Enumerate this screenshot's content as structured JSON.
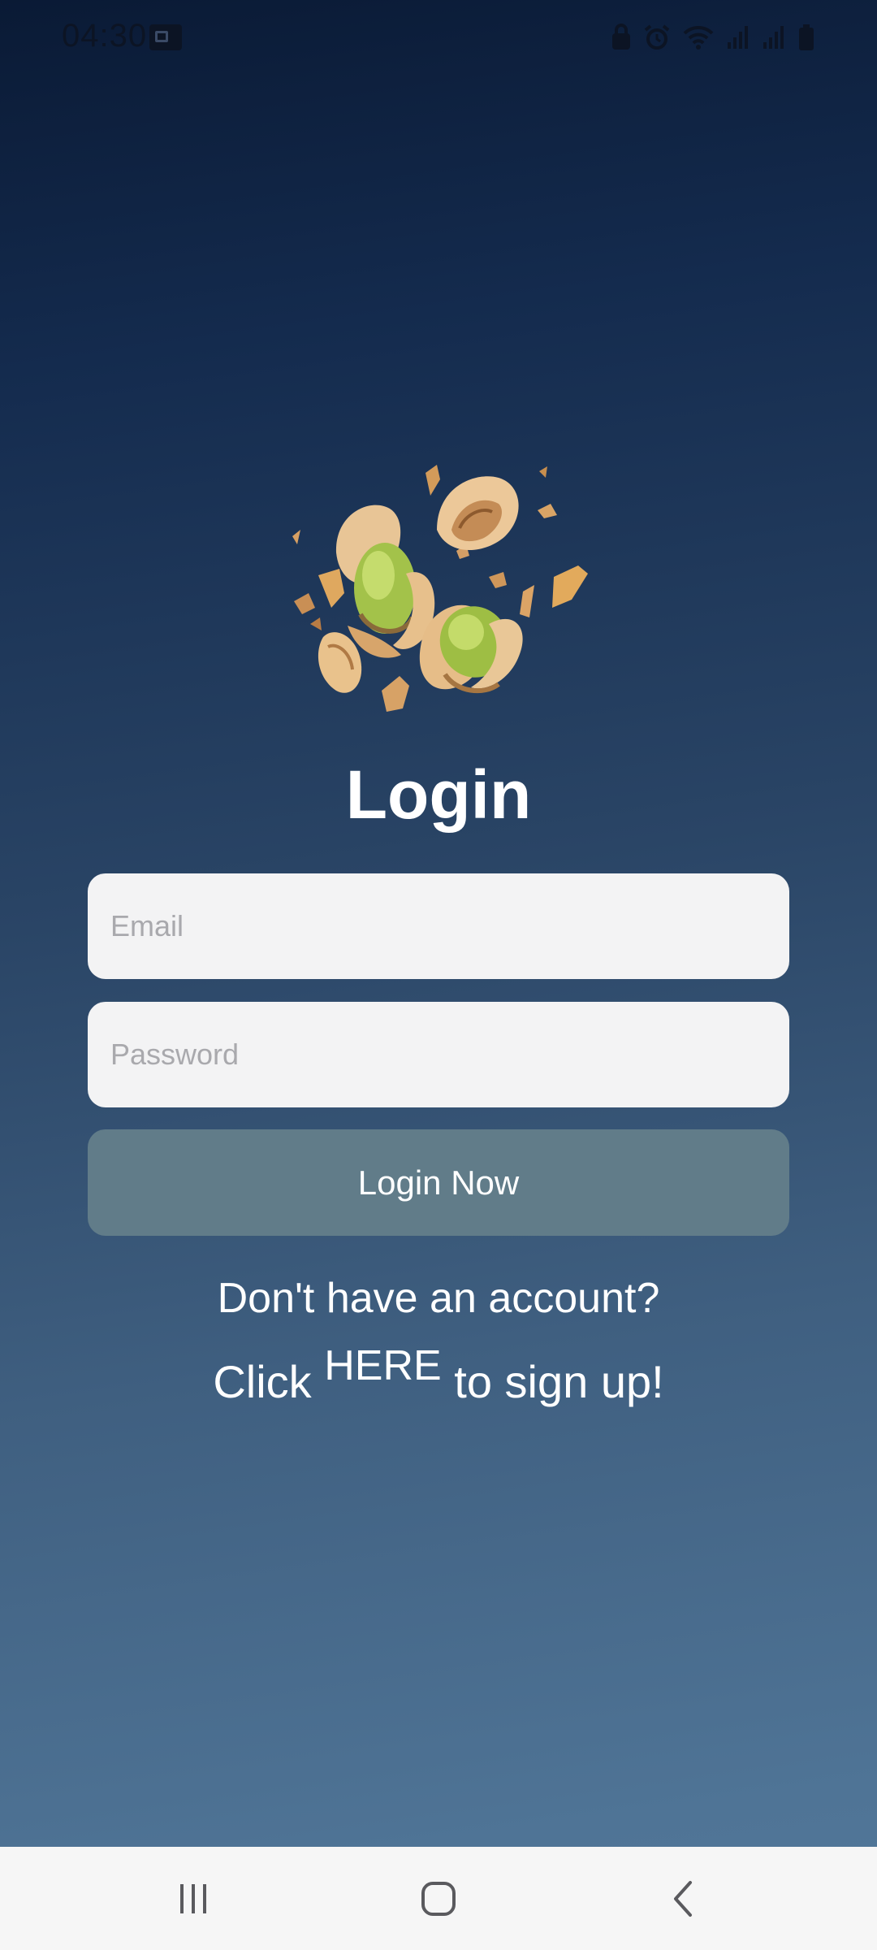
{
  "status_bar": {
    "time": "04:30",
    "left_icon": "notification-badge-icon",
    "right_icons": [
      "lock-icon",
      "alarm-icon",
      "wifi-icon",
      "signal-icon",
      "signal-icon",
      "battery-icon"
    ]
  },
  "logo": {
    "icon": "pistachio-logo-icon"
  },
  "login": {
    "title": "Login",
    "email_placeholder": "Email",
    "email_value": "",
    "password_placeholder": "Password",
    "password_value": "",
    "button_label": "Login Now"
  },
  "signup": {
    "question": "Don't have an account?",
    "prefix": "Click",
    "link_label": "HERE",
    "suffix": "to sign up!"
  },
  "nav_bar": {
    "recents_icon": "recents-icon",
    "home_icon": "home-icon",
    "back_icon": "back-icon"
  },
  "colors": {
    "background_top": "#0a1a35",
    "background_bottom": "#52789a",
    "field_bg": "#f3f3f4",
    "button_bg": "#617c89",
    "nav_bar_bg": "#f6f6f6"
  }
}
